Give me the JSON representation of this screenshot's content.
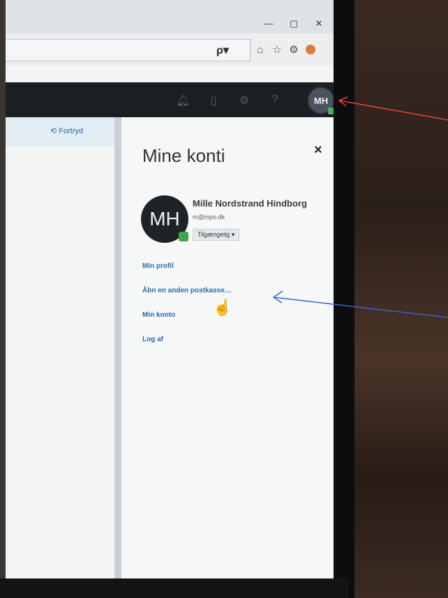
{
  "browser": {
    "window_controls": [
      "—",
      "▢",
      "✕"
    ],
    "search_button_label": "ρ▾",
    "toolbar_icons": [
      "home-icon",
      "star-icon",
      "settings-icon",
      "smiley-icon"
    ]
  },
  "app_header": {
    "icons": [
      "bell-icon",
      "calendar-icon",
      "gear-icon",
      "help-icon"
    ],
    "help_label": "?",
    "avatar_initials": "MH"
  },
  "left_pane": {
    "undo_label": "⟲ Fortryd"
  },
  "account_panel": {
    "title": "Mine konti",
    "close_label": "×",
    "avatar_initials": "MH",
    "user_name": "Mille Nordstrand Hindborg",
    "user_email": "m@mpo.dk",
    "status_label": "Tilgængelig ▾",
    "links": [
      {
        "label": "Min profil"
      },
      {
        "label": "Åbn en anden postkasse…"
      },
      {
        "label": "Min konto"
      },
      {
        "label": "Log af"
      }
    ]
  },
  "annotations": {
    "red_arrow_color": "#e0453a",
    "blue_arrow_color": "#3b64c8"
  }
}
